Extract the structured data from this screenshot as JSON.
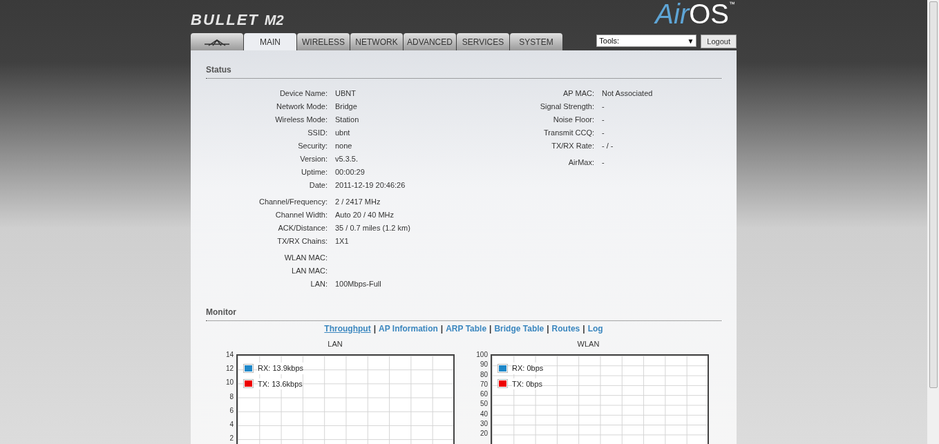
{
  "logo": {
    "product": "BULLET",
    "model": "M2",
    "brand_air": "Air",
    "brand_os": "OS",
    "trademark": "™"
  },
  "tabs": [
    {
      "kind": "logo",
      "selected": false
    },
    {
      "kind": "text",
      "label": "MAIN",
      "selected": true
    },
    {
      "kind": "text",
      "label": "WIRELESS",
      "selected": false
    },
    {
      "kind": "text",
      "label": "NETWORK",
      "selected": false
    },
    {
      "kind": "text",
      "label": "ADVANCED",
      "selected": false
    },
    {
      "kind": "text",
      "label": "SERVICES",
      "selected": false
    },
    {
      "kind": "text",
      "label": "SYSTEM",
      "selected": false
    }
  ],
  "tools": {
    "value": "Tools:",
    "arrow": "▼"
  },
  "logout": "Logout",
  "status": {
    "title": "Status",
    "left": [
      [
        {
          "label": "Device Name:",
          "value": "UBNT"
        },
        {
          "label": "Network Mode:",
          "value": "Bridge"
        },
        {
          "label": "Wireless Mode:",
          "value": "Station"
        },
        {
          "label": "SSID:",
          "value": "ubnt"
        },
        {
          "label": "Security:",
          "value": "none"
        },
        {
          "label": "Version:",
          "value": "v5.3.5."
        },
        {
          "label": "Uptime:",
          "value": "00:00:29"
        },
        {
          "label": "Date:",
          "value": "2011-12-19 20:46:26"
        }
      ],
      [
        {
          "label": "Channel/Frequency:",
          "value": "2 / 2417 MHz"
        },
        {
          "label": "Channel Width:",
          "value": "Auto 20 / 40 MHz"
        },
        {
          "label": "ACK/Distance:",
          "value": "35 / 0.7 miles (1.2 km)"
        },
        {
          "label": "TX/RX Chains:",
          "value": "1X1"
        }
      ],
      [
        {
          "label": "WLAN MAC:"
        },
        {
          "label": "LAN MAC:"
        },
        {
          "label": "LAN:",
          "value": "100Mbps-Full"
        }
      ]
    ],
    "right": [
      [
        {
          "label": "AP MAC:",
          "value": "Not Associated"
        },
        {
          "label": "Signal Strength:",
          "value": "-"
        },
        {
          "label": "Noise Floor:",
          "value": "-"
        },
        {
          "label": "Transmit CCQ:",
          "value": "-"
        },
        {
          "label": "TX/RX Rate:",
          "value": "- / -"
        }
      ],
      [
        {
          "label": "AirMax:",
          "value": "-"
        }
      ]
    ]
  },
  "monitor": {
    "title": "Monitor",
    "links": [
      {
        "label": "Throughput",
        "selected": true
      },
      {
        "label": "AP Information",
        "selected": false
      },
      {
        "label": "ARP Table",
        "selected": false
      },
      {
        "label": "Bridge Table",
        "selected": false
      },
      {
        "label": "Routes",
        "selected": false
      },
      {
        "label": "Log",
        "selected": false
      }
    ],
    "separator": "|",
    "charts": [
      {
        "title": "LAN",
        "yticks": [
          "14",
          "12",
          "10",
          "8",
          "6",
          "4",
          "2"
        ],
        "legend": [
          {
            "label": "RX: 13.9kbps",
            "color": "#1f88c9"
          },
          {
            "label": "TX: 13.6kbps",
            "color": "#ee0000"
          }
        ]
      },
      {
        "title": "WLAN",
        "yticks": [
          "100",
          "90",
          "80",
          "70",
          "60",
          "50",
          "40",
          "30",
          "20"
        ],
        "legend": [
          {
            "label": "RX: 0bps",
            "color": "#1f88c9"
          },
          {
            "label": "TX: 0bps",
            "color": "#ee0000"
          }
        ]
      }
    ]
  }
}
